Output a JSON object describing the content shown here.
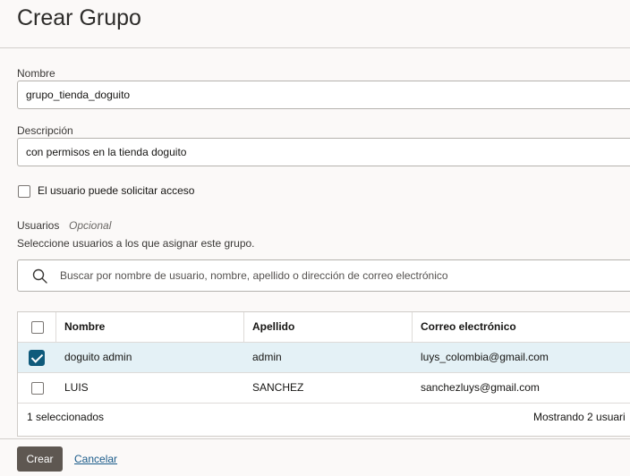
{
  "page": {
    "title": "Crear Grupo"
  },
  "form": {
    "name_label": "Nombre",
    "name_value": "grupo_tienda_doguito",
    "description_label": "Descripción",
    "description_value": "con permisos en la tienda doguito",
    "request_access_label": "El usuario puede solicitar acceso",
    "users_label": "Usuarios",
    "users_optional": "Opcional",
    "users_help": "Seleccione usuarios a los que asignar este grupo."
  },
  "search": {
    "placeholder": "Buscar por nombre de usuario, nombre, apellido o dirección de correo electrónico"
  },
  "table": {
    "columns": [
      "Nombre",
      "Apellido",
      "Correo electrónico"
    ],
    "rows": [
      {
        "selected": true,
        "first_name": "doguito admin",
        "last_name": "admin",
        "email": "luys_colombia@gmail.com"
      },
      {
        "selected": false,
        "first_name": "LUIS",
        "last_name": "SANCHEZ",
        "email": "sanchezluys@gmail.com"
      }
    ],
    "footer_selected": "1 seleccionados",
    "footer_showing": "Mostrando 2 usuari"
  },
  "actions": {
    "create_label": "Crear",
    "cancel_label": "Cancelar"
  },
  "colors": {
    "primary_button": "#5e5751",
    "selected_row": "#e4f1f6",
    "checkbox_checked": "#0f5a7b",
    "link": "#1a5b8a"
  }
}
